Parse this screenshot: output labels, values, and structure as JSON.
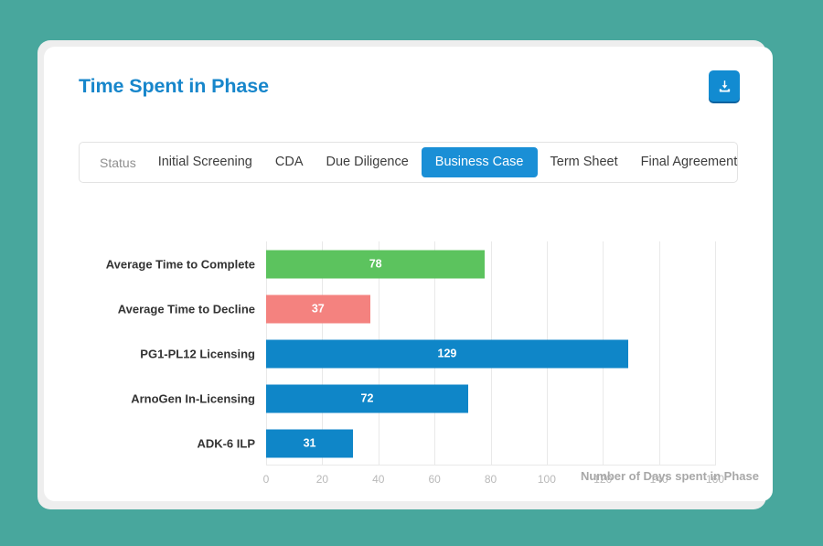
{
  "theme": {
    "page_background": "#48a79d",
    "frame_background": "#eeeeee",
    "card_background": "#ffffff",
    "title_color": "#1786cb",
    "accent_blue": "#1a8fd6",
    "bar_blue": "#0f86c8",
    "bar_green": "#5cc35e",
    "bar_red": "#f4827f",
    "gridline_color": "#e9e9e9",
    "tick_color": "#b9b9b9"
  },
  "header": {
    "title": "Time Spent in Phase",
    "download_button": {
      "icon": "download-icon",
      "label": ""
    }
  },
  "tabbar": {
    "label": "Status",
    "tabs": [
      {
        "label": "Initial Screening",
        "active": false
      },
      {
        "label": "CDA",
        "active": false
      },
      {
        "label": "Due Diligence",
        "active": false
      },
      {
        "label": "Business Case",
        "active": true
      },
      {
        "label": "Term Sheet",
        "active": false
      },
      {
        "label": "Final Agreement",
        "active": false
      }
    ]
  },
  "chart_data": {
    "type": "bar",
    "orientation": "horizontal",
    "title": "Time Spent in Phase",
    "xlabel": "Number of Days spent in Phase",
    "ylabel": "",
    "xlim": [
      0,
      160
    ],
    "xticks": [
      0,
      20,
      40,
      60,
      80,
      100,
      120,
      140,
      160
    ],
    "grid": true,
    "legend": "none",
    "categories": [
      "Average Time to Complete",
      "Average Time to Decline",
      "PG1-PL12 Licensing",
      "ArnoGen In-Licensing",
      "ADK-6 ILP"
    ],
    "values": [
      78,
      37,
      129,
      72,
      31
    ],
    "colors": [
      "#5cc35e",
      "#f4827f",
      "#0f86c8",
      "#0f86c8",
      "#0f86c8"
    ],
    "bars": [
      {
        "category": "Average Time to Complete",
        "value": 78,
        "label": "78",
        "color": "#5cc35e"
      },
      {
        "category": "Average Time to Decline",
        "value": 37,
        "label": "37",
        "color": "#f4827f"
      },
      {
        "category": "PG1-PL12 Licensing",
        "value": 129,
        "label": "129",
        "color": "#0f86c8"
      },
      {
        "category": "ArnoGen In-Licensing",
        "value": 72,
        "label": "72",
        "color": "#0f86c8"
      },
      {
        "category": "ADK-6 ILP",
        "value": 31,
        "label": "31",
        "color": "#0f86c8"
      }
    ]
  }
}
